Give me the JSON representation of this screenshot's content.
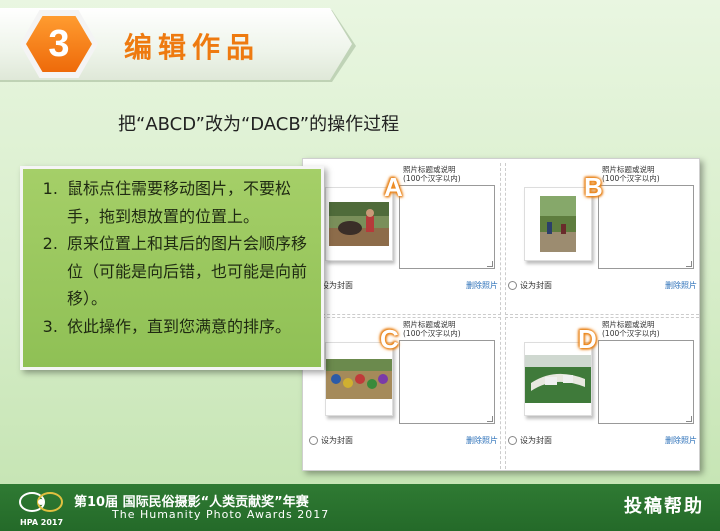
{
  "header": {
    "step_number": "3",
    "title": "编辑作品"
  },
  "subtitle": "把“ABCD”改为“DACB”的操作过程",
  "instructions": [
    "鼠标点住需要移动图片，不要松手，拖到想放置的位置上。",
    "原来位置上和其后的图片会顺序移位（可能是向后错，也可能是向前移）。",
    "依此操作，直到您满意的排序。"
  ],
  "photo_cells": [
    {
      "letter": "A",
      "caption_label": "照片标题或说明",
      "caption_hint": "(100个汉字以内)",
      "cover_label": "设为封面",
      "delete_label": "删除照片"
    },
    {
      "letter": "B",
      "caption_label": "照片标题或说明",
      "caption_hint": "(100个汉字以内)",
      "cover_label": "设为封面",
      "delete_label": "删除照片"
    },
    {
      "letter": "C",
      "caption_label": "照片标题或说明",
      "caption_hint": "(100个汉字以内)",
      "cover_label": "设为封面",
      "delete_label": "删除照片"
    },
    {
      "letter": "D",
      "caption_label": "照片标题或说明",
      "caption_hint": "(100个汉字以内)",
      "cover_label": "设为封面",
      "delete_label": "删除照片"
    }
  ],
  "footer": {
    "title": "第10届 国际民俗摄影“人类贡献奖”年赛",
    "subtitle_en": "The Humanity Photo Awards 2017",
    "logo_text": "HPA 2017",
    "help_link": "投稿帮助"
  },
  "colors": {
    "accent_orange": "#ee7a10",
    "note_green": "#9ac95e",
    "footer_green": "#2a7430",
    "link_blue": "#2a6fb8"
  }
}
